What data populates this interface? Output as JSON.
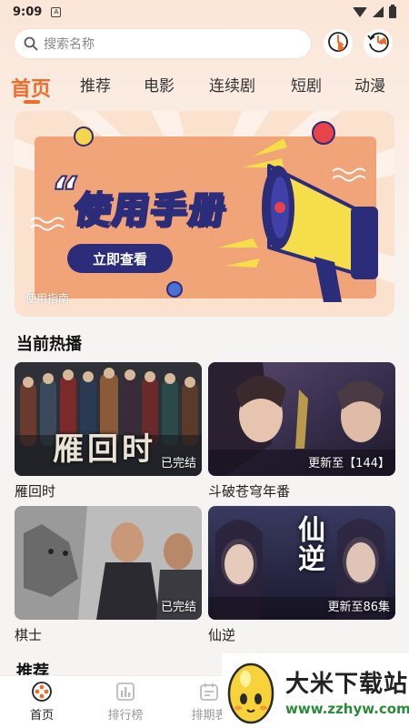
{
  "status_bar": {
    "time": "9:09",
    "notification_glyph": "A"
  },
  "search": {
    "placeholder": "搜索名称"
  },
  "header_buttons": [
    {
      "icon": "history-clock-icon"
    },
    {
      "icon": "refresh-clock-icon"
    }
  ],
  "tabs": [
    {
      "label": "首页",
      "active": true
    },
    {
      "label": "推荐",
      "active": false
    },
    {
      "label": "电影",
      "active": false
    },
    {
      "label": "连续剧",
      "active": false
    },
    {
      "label": "短剧",
      "active": false
    },
    {
      "label": "动漫",
      "active": false
    }
  ],
  "banner": {
    "headline": "使用手册",
    "quote_mark": "“",
    "button_label": "立即查看",
    "caption": "使用指南"
  },
  "section_now_playing": {
    "title": "当前热播"
  },
  "cards": [
    {
      "title": "雁回时",
      "status": "已完结",
      "poster_text": "雁回时"
    },
    {
      "title": "斗破苍穹年番",
      "status": "更新至【144】",
      "poster_text": ""
    },
    {
      "title": "棋士",
      "status": "已完结",
      "poster_text": ""
    },
    {
      "title": "仙逆",
      "status": "更新至86集",
      "poster_text": "仙逆"
    }
  ],
  "section_recommend": {
    "title": "推荐"
  },
  "bottom_nav": [
    {
      "label": "首页",
      "icon": "home-reel-icon",
      "active": true
    },
    {
      "label": "排行榜",
      "icon": "chart-icon",
      "active": false
    },
    {
      "label": "排期表",
      "icon": "calendar-icon",
      "active": false
    }
  ],
  "watermark": {
    "name": "大米下载站",
    "url": "www.zzhyw.com"
  },
  "colors": {
    "accent": "#ef6c2b",
    "banner_orange": "#f3a878",
    "banner_navy": "#2b2c7a",
    "banner_yellow": "#f6dd4a"
  }
}
